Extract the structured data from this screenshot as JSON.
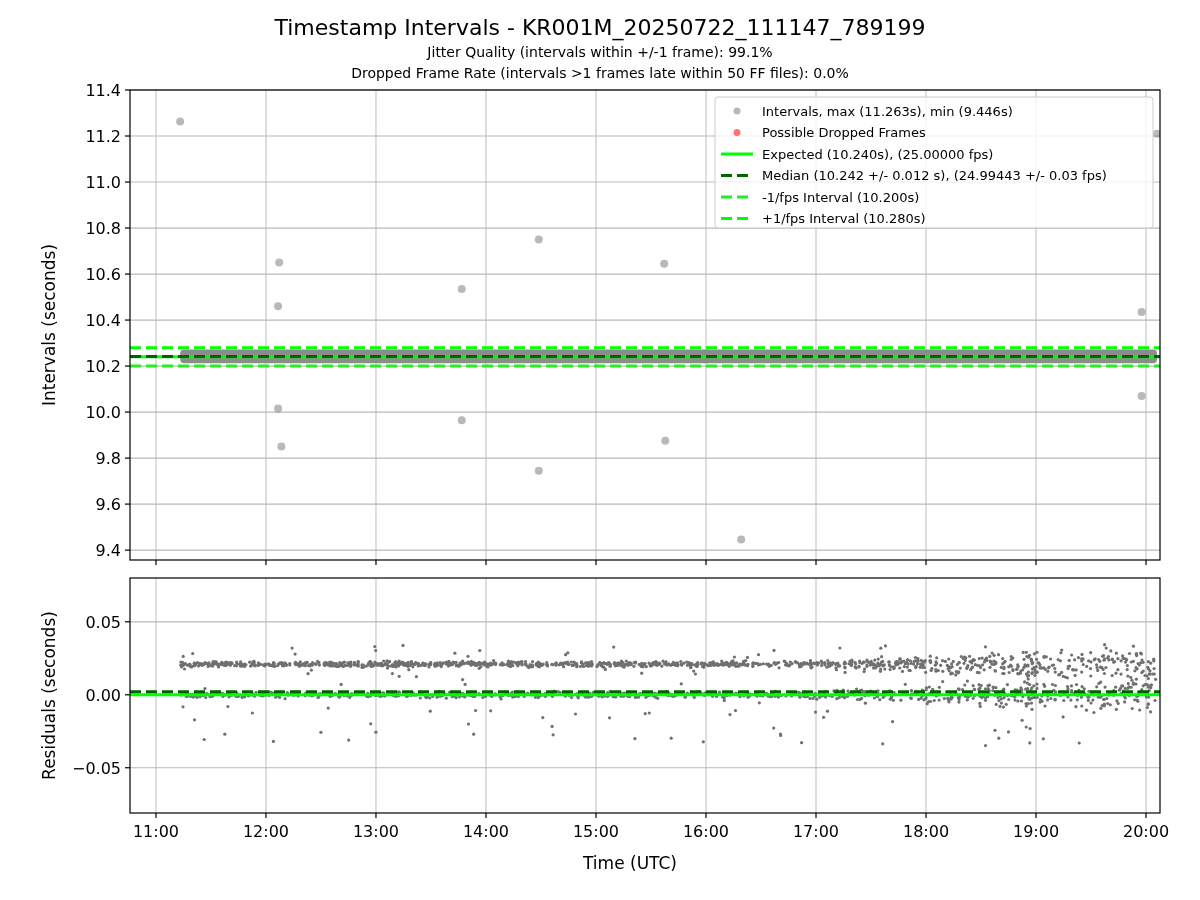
{
  "figure": {
    "title": "Timestamp Intervals - KR001M_20250722_111147_789199",
    "subtitles": [
      "Jitter Quality (intervals within +/-1 frame): 99.1%",
      "Dropped Frame Rate (intervals >1 frames late within 50 FF files): 0.0%"
    ]
  },
  "charts": [
    {
      "chart_data": {
        "type": "scatter",
        "ylabel": "Intervals (seconds)",
        "grid": true,
        "legend": "upper right",
        "x": [
          11.22,
          12.12,
          12.11,
          12.11,
          12.14,
          13.78,
          13.78,
          14.48,
          14.48,
          15.62,
          15.63,
          16.32,
          19.96,
          19.96,
          20.1
        ],
        "series": [
          {
            "name": "Intervals, max (11.263s), min (9.446s)",
            "color": "#808080",
            "values": [
              11.263,
              10.65,
              10.46,
              10.015,
              9.85,
              10.535,
              9.965,
              10.75,
              9.745,
              10.645,
              9.875,
              9.446,
              10.435,
              10.07,
              11.21
            ]
          },
          {
            "name": "Possible Dropped Frames",
            "color": "#ff0000",
            "values": [
              null,
              null,
              null,
              null,
              null,
              null,
              null,
              null,
              null,
              null,
              null,
              null,
              null,
              null,
              null
            ]
          }
        ],
        "xlim": [
          10.764,
          20.127
        ],
        "ylim": [
          9.357,
          11.4
        ],
        "yticks": [
          {
            "value": 9.4,
            "label": "9.4"
          },
          {
            "value": 9.6,
            "label": "9.6"
          },
          {
            "value": 9.8,
            "label": "9.8"
          },
          {
            "value": 10.0,
            "label": "10.0"
          },
          {
            "value": 10.2,
            "label": "10.2"
          },
          {
            "value": 10.4,
            "label": "10.4"
          },
          {
            "value": 10.6,
            "label": "10.6"
          },
          {
            "value": 10.8,
            "label": "10.8"
          },
          {
            "value": 11.0,
            "label": "11.0"
          },
          {
            "value": 11.2,
            "label": "11.2"
          },
          {
            "value": 11.4,
            "label": "11.4"
          }
        ],
        "bands": [
          {
            "axis": "y",
            "from": 10.212,
            "to": 10.272,
            "color": "#808080"
          }
        ],
        "ref_lines": [
          {
            "axis": "y",
            "value": 10.24,
            "label": "Expected (10.240s), (25.00000 fps)",
            "color": "#00ff00"
          },
          {
            "axis": "y",
            "value": 10.242,
            "label": "Median (10.242 +/- 0.012 s), (24.99443 +/- 0.03 fps)",
            "color": "#006400"
          },
          {
            "axis": "y",
            "value": 10.2,
            "label": "-1/fps Interval (10.200s)",
            "color": "#22ee22"
          },
          {
            "axis": "y",
            "value": 10.28,
            "label": "+1/fps Interval (10.280s)",
            "color": "#00ff00"
          }
        ]
      }
    },
    {
      "chart_data": {
        "type": "scatter",
        "xlabel": "Time (UTC)",
        "ylabel": "Residuals (seconds)",
        "grid": true,
        "xlim": [
          10.764,
          20.127
        ],
        "ylim": [
          -0.081,
          0.08
        ],
        "xticks": [
          {
            "value": 11,
            "label": "11:00"
          },
          {
            "value": 12,
            "label": "12:00"
          },
          {
            "value": 13,
            "label": "13:00"
          },
          {
            "value": 14,
            "label": "14:00"
          },
          {
            "value": 15,
            "label": "15:00"
          },
          {
            "value": 16,
            "label": "16:00"
          },
          {
            "value": 17,
            "label": "17:00"
          },
          {
            "value": 18,
            "label": "18:00"
          },
          {
            "value": 19,
            "label": "19:00"
          },
          {
            "value": 20,
            "label": "20:00"
          }
        ],
        "yticks": [
          {
            "value": -0.05,
            "label": "−0.05"
          },
          {
            "value": 0,
            "label": "0.00"
          },
          {
            "value": 0.05,
            "label": "0.05"
          }
        ],
        "ref_lines": [
          {
            "axis": "y",
            "value": 0,
            "color": "#00ff00"
          },
          {
            "axis": "y",
            "value": 0.002,
            "color": "#006400"
          }
        ]
      }
    }
  ]
}
